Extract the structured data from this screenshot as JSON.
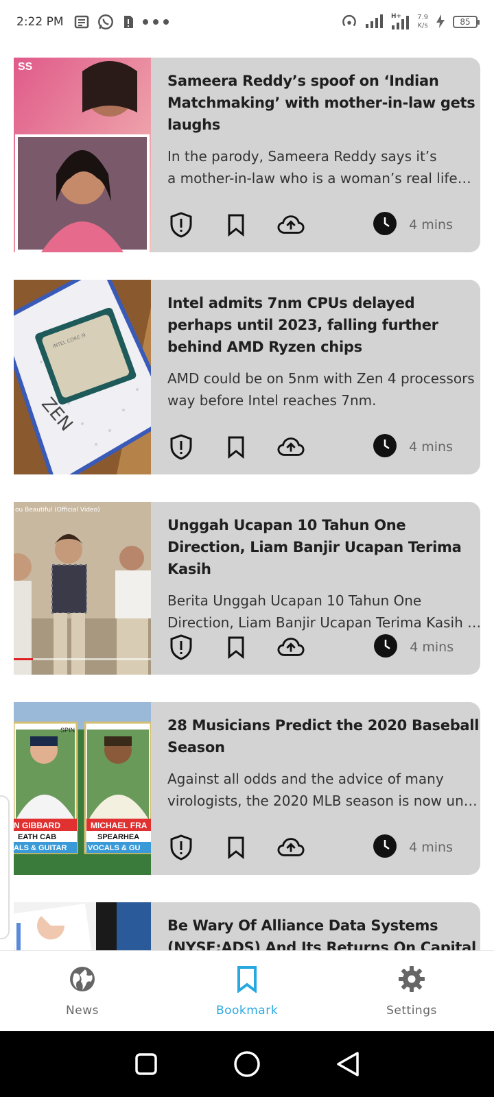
{
  "status_bar": {
    "time": "2:22 PM",
    "net_speed_value": "7.9",
    "net_speed_unit": "K/s",
    "battery": "85",
    "icons": [
      "news-app-icon",
      "whatsapp-icon",
      "sim-alert-icon",
      "more-dots-icon",
      "hotspot-icon",
      "signal-icon",
      "signal-h-plus-icon",
      "charging-icon",
      "battery-icon"
    ]
  },
  "articles": [
    {
      "title": "Sameera Reddy’s spoof on ‘Indian Matchmaking’ with mother-in-law gets laughs",
      "desc_line1": "In the parody, Sameera Reddy says it’s",
      "desc_line2": "a mother-in-law who is a woman’s real life…",
      "read_time": "4 mins"
    },
    {
      "title": "Intel admits 7nm CPUs delayed perhaps until 2023, falling further behind AMD Ryzen chips",
      "desc_line1": "AMD could be on 5nm with Zen 4 processors",
      "desc_line2": "way before Intel reaches 7nm.",
      "read_time": "4 mins"
    },
    {
      "title": "Unggah Ucapan 10 Tahun One Direction, Liam Banjir Ucapan Terima Kasih",
      "desc_line1": "Berita Unggah Ucapan 10 Tahun One",
      "desc_line2": "Direction, Liam Banjir Ucapan Terima Kasih …",
      "read_time": "4 mins",
      "thumb_caption": "ou Beautiful (Official Video)"
    },
    {
      "title": "28 Musicians Predict the 2020 Baseball Season",
      "desc_line1": "Against all odds and the advice of many",
      "desc_line2": "virologists, the 2020 MLB season is now un…",
      "read_time": "4 mins",
      "thumb_text": [
        "N GIBBARD",
        "EATH CAB",
        "ALS & GUITAR",
        "MICHAEL FRA",
        "SPEARHEA",
        "VOCALS & GU",
        "SPIN"
      ]
    },
    {
      "title": "Be Wary Of Alliance Data Systems (NYSE:ADS) And Its Returns On Capital"
    }
  ],
  "thumb1_badge": "SS",
  "bottom_nav": {
    "news_label": "News",
    "bookmark_label": "Bookmark",
    "settings_label": "Settings",
    "active": "Bookmark",
    "active_color": "#29a8e0"
  },
  "colors": {
    "card_bg": "#d3d3d3",
    "accent": "#29a8e0"
  }
}
